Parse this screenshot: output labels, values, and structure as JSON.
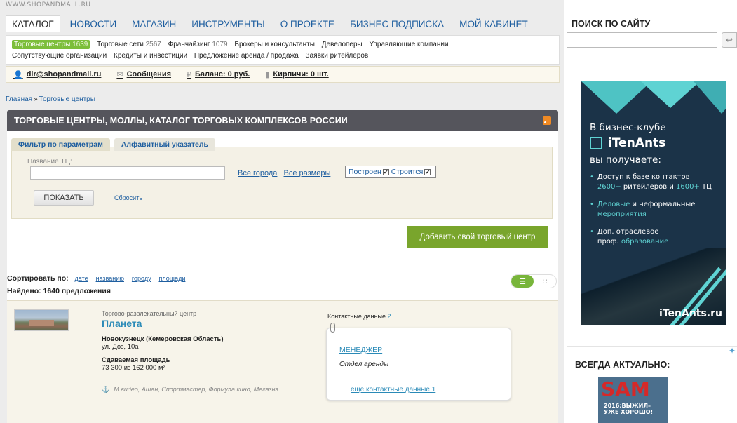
{
  "site_url": "WWW.SHOPANDMALL.RU",
  "main_nav": [
    {
      "label": "КАТАЛОГ",
      "active": true
    },
    {
      "label": "НОВОСТИ"
    },
    {
      "label": "МАГАЗИН"
    },
    {
      "label": "ИНСТРУМЕНТЫ"
    },
    {
      "label": "О ПРОЕКТЕ"
    },
    {
      "label": "БИЗНЕС ПОДПИСКА"
    },
    {
      "label": "МОЙ КАБИНЕТ"
    }
  ],
  "sub_nav": {
    "row1": [
      {
        "label": "Торговые центры",
        "count": "1639",
        "active": true
      },
      {
        "label": "Торговые сети",
        "count": "2567"
      },
      {
        "label": "Франчайзинг",
        "count": "1079"
      },
      {
        "label": "Брокеры и консультанты",
        "count": ""
      },
      {
        "label": "Девелоперы",
        "count": ""
      },
      {
        "label": "Управляющие компании",
        "count": ""
      }
    ],
    "row2": [
      {
        "label": "Сопутствующие организации"
      },
      {
        "label": "Кредиты и инвестиции"
      },
      {
        "label": "Предложение аренда / продажа"
      },
      {
        "label": "Заявки ритейлеров"
      }
    ]
  },
  "user_bar": {
    "email": "dir@shopandmall.ru",
    "messages": "Сообщения",
    "balance": "Баланс: 0 руб.",
    "bricks": "Кирпичи: 0 шт."
  },
  "breadcrumb": {
    "home": "Главная",
    "sep": "»",
    "current": "Торговые центры"
  },
  "panel_title": "ТОРГОВЫЕ ЦЕНТРЫ, МОЛЛЫ, КАТАЛОГ ТОРГОВЫХ КОМПЛЕКСОВ РОССИИ",
  "filter": {
    "tabs": [
      "Фильтр по параметрам",
      "Алфавитный указатель"
    ],
    "name_label": "Название ТЦ:",
    "name_value": "",
    "all_cities": "Все города",
    "all_sizes": "Все размеры",
    "built": "Построен",
    "building": "Строится",
    "show_button": "ПОКАЗАТЬ",
    "reset": "Сбросить"
  },
  "add_button": "Добавить свой торговый центр",
  "sort": {
    "label": "Сортировать по:",
    "options": [
      "дате",
      "названию",
      "городу",
      "площади"
    ],
    "found": "Найдено: 1640 предложения"
  },
  "listing": {
    "type": "Торгово-развлекательный центр",
    "name": "Планета",
    "city": "Новокузнецк (Кемеровская Область)",
    "address": "ул. Доз, 10а",
    "area_label": "Сдаваемая площадь",
    "area_value": "73 300 из 162 000 м²",
    "tenants": "М.видео, Ашан, Спортмастер, Формула кино, Мегазнэ",
    "contacts_label": "Контактные данные",
    "contacts_count": "2",
    "contact_role": "МЕНЕДЖЕР",
    "contact_dept": "Отдел аренды",
    "more_contacts": "еще контактные данные 1"
  },
  "sidebar": {
    "search_title": "ПОИСК ПО САЙТУ",
    "search_value": "",
    "search_btn_icon": "↩",
    "ad": {
      "line1": "В бизнес-клубе",
      "brand": "iTenAnts",
      "line2": "вы получаете:",
      "item1_a": "Доступ к базе контактов",
      "item1_b": "2600+",
      "item1_c": " ритейлеров и ",
      "item1_d": "1600+",
      "item1_e": " ТЦ",
      "item2_a": "Деловые",
      "item2_b": " и неформальные",
      "item2_c": "мероприятия",
      "item3_a": "Доп. отраслевое",
      "item3_b": "проф. ",
      "item3_c": "образование",
      "url": "iTenAnts.ru"
    },
    "actual_title": "ВСЕГДА АКТУАЛЬНО:",
    "magazine_title": "SAM",
    "magazine_sub": "2016:ВЫЖИЛ– УЖЕ ХОРОШО!"
  },
  "colors": {
    "accent_green": "#79a52c",
    "title_bar": "#55555c",
    "link": "#1f5fa0",
    "ad_bg": "#1b3348",
    "ad_accent": "#5fd3d3"
  }
}
